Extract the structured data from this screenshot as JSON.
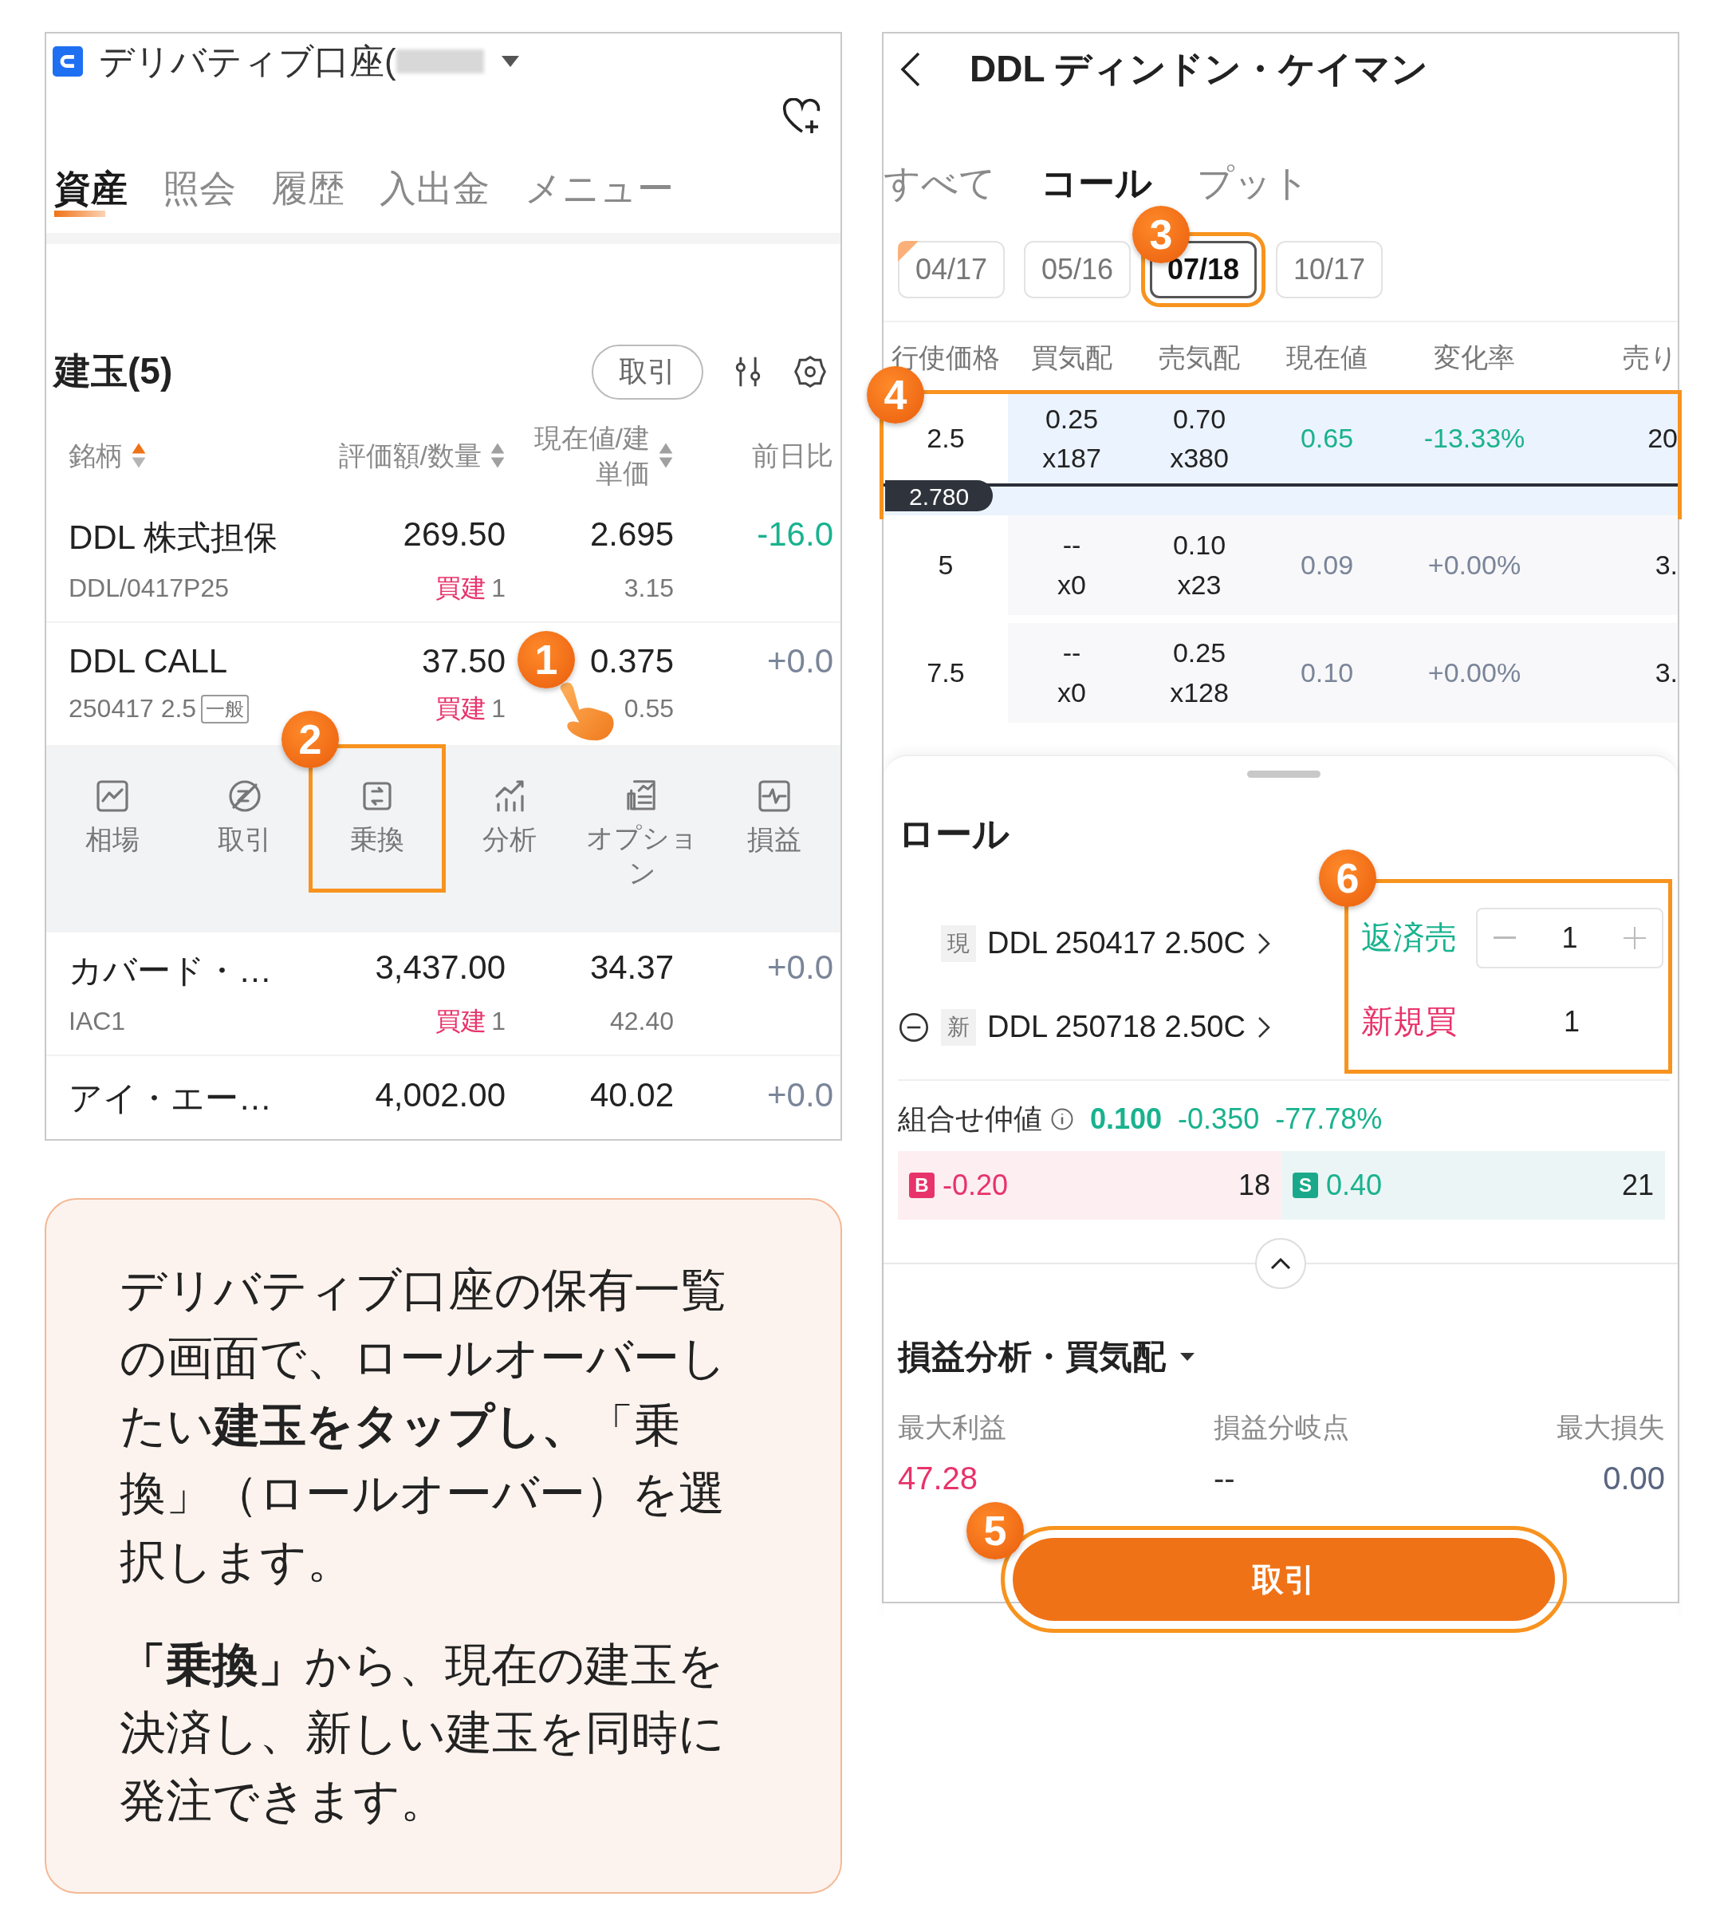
{
  "left_screen": {
    "account": {
      "title": "デリバティブ口座("
    },
    "tabs": [
      {
        "label": "資産",
        "selected": true
      },
      {
        "label": "照会",
        "selected": false
      },
      {
        "label": "履歴",
        "selected": false
      },
      {
        "label": "入出金",
        "selected": false
      },
      {
        "label": "メニュー",
        "selected": false
      }
    ],
    "positions": {
      "title": "建玉(5)",
      "trade_button": "取引",
      "columns": [
        {
          "label": "銘柄",
          "sortable": true,
          "sorted": true
        },
        {
          "label": "評価額/数量",
          "sortable": true,
          "sorted": false
        },
        {
          "label": "現在値/建単価",
          "sortable": true,
          "sorted": false
        },
        {
          "label": "前日比",
          "sortable": false
        }
      ],
      "rows": [
        {
          "name": "DDL 株式担保",
          "code": "DDL/0417P25",
          "value": "269.50",
          "side": "買建",
          "qty": "1",
          "price": "2.695",
          "cost": "3.15",
          "change": "-16.0",
          "falling": true,
          "expanded": false
        },
        {
          "name": "DDL CALL",
          "code": "250417 2.5",
          "tag": "一般",
          "value": "37.50",
          "side": "買建",
          "qty": "1",
          "price": "0.375",
          "cost": "0.55",
          "change": "+0.0",
          "falling": false,
          "expanded": true,
          "step": "1"
        },
        {
          "name": "カバード・…",
          "code": "IAC1",
          "value": "3,437.00",
          "side": "買建",
          "qty": "1",
          "price": "34.37",
          "cost": "42.40",
          "change": "+0.0",
          "falling": false,
          "expanded": false
        },
        {
          "name": "アイ・エー…",
          "value": "4,002.00",
          "price": "40.02",
          "change": "+0.0",
          "falling": false,
          "expanded": false
        }
      ],
      "actions": [
        {
          "label": "相場"
        },
        {
          "label": "取引"
        },
        {
          "label": "乗換",
          "step": "2"
        },
        {
          "label": "分析"
        },
        {
          "label": "オプション"
        },
        {
          "label": "損益"
        }
      ]
    }
  },
  "right_screen": {
    "title": "DDL ディンドン・ケイマン",
    "type_tabs": [
      {
        "label": "すべて",
        "selected": false
      },
      {
        "label": "コール",
        "selected": true
      },
      {
        "label": "プット",
        "selected": false
      }
    ],
    "expiries": [
      {
        "label": "04/17",
        "selected": false,
        "flagged": true
      },
      {
        "label": "05/16",
        "selected": false,
        "flagged": false
      },
      {
        "label": "07/18",
        "selected": true,
        "flagged": false,
        "step": "3"
      },
      {
        "label": "10/17",
        "selected": false,
        "flagged": false
      }
    ],
    "chain": {
      "columns": [
        "行使価格",
        "買気配",
        "売気配",
        "現在値",
        "変化率",
        "売り"
      ],
      "rows": [
        {
          "strike": "2.5",
          "bid": "0.25",
          "bid_size": "x187",
          "ask": "0.70",
          "ask_size": "x380",
          "last": "0.65",
          "change": "-13.33%",
          "column_6": "20",
          "falling": true,
          "selected": true,
          "price_marker": "2.780",
          "step": "4"
        },
        {
          "strike": "5",
          "bid": "--",
          "bid_size": "x0",
          "ask": "0.10",
          "ask_size": "x23",
          "last": "0.09",
          "change": "+0.00%",
          "column_6": "3.",
          "falling": false,
          "selected": false
        },
        {
          "strike": "7.5",
          "bid": "--",
          "bid_size": "x0",
          "ask": "0.25",
          "ask_size": "x128",
          "last": "0.10",
          "change": "+0.00%",
          "column_6": "3.",
          "falling": false,
          "selected": false
        }
      ]
    },
    "roll": {
      "title": "ロール",
      "step": "6",
      "legs": [
        {
          "tag": "現",
          "contract": "DDL 250417 2.50C",
          "removable": false,
          "side": "返済売",
          "kind": "sell",
          "qty": "1",
          "stepper": true
        },
        {
          "tag": "新",
          "contract": "DDL 250718 2.50C",
          "removable": true,
          "side": "新規買",
          "kind": "buy",
          "qty": "1",
          "stepper": false
        }
      ],
      "combo": {
        "label": "組合せ仲値",
        "mid": "0.100",
        "change": "-0.350",
        "change_pct": "-77.78%"
      },
      "book": [
        {
          "side": "B",
          "kind": "buy",
          "price": "-0.20",
          "size": "18"
        },
        {
          "side": "S",
          "kind": "sell",
          "price": "0.40",
          "size": "21"
        }
      ]
    },
    "analysis": {
      "title": "損益分析・買気配",
      "stats": [
        {
          "label": "最大利益",
          "value": "47.28",
          "kind": "profit"
        },
        {
          "label": "損益分岐点",
          "value": "--",
          "kind": "neutral"
        },
        {
          "label": "最大損失",
          "value": "0.00",
          "kind": "loss"
        }
      ]
    },
    "trade_button": {
      "label": "取引",
      "step": "5"
    }
  },
  "note": {
    "paragraphs": [
      "デリバティブ口座の保有一覧の画面で、ロールオーバーしたい**建玉をタップし、**「乗換」（ロールオーバー）を選択します。",
      "**「乗換」**から、現在の建玉を決済し、新しい建玉を同時に発注できます。"
    ]
  }
}
